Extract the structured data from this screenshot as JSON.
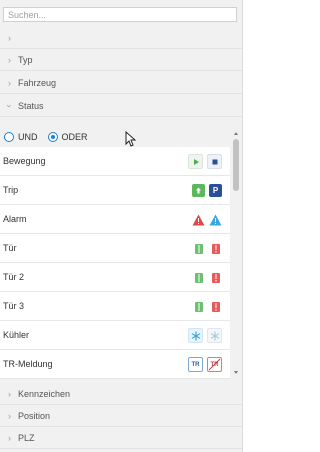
{
  "search": {
    "placeholder": "Suchen..."
  },
  "groups": {
    "unnamed": {
      "label": ""
    },
    "typ": {
      "label": "Typ"
    },
    "fahrzeug": {
      "label": "Fahrzeug"
    },
    "status": {
      "label": "Status",
      "expanded": true
    },
    "kennzeichen": {
      "label": "Kennzeichen"
    },
    "position": {
      "label": "Position"
    },
    "plz": {
      "label": "PLZ"
    }
  },
  "logic": {
    "und_label": "UND",
    "oder_label": "ODER",
    "selected": "ODER"
  },
  "status_items": [
    {
      "label": "Bewegung",
      "icons": [
        "play-icon",
        "stop-icon"
      ]
    },
    {
      "label": "Trip",
      "icons": [
        "trip-start-icon",
        "parking-icon"
      ]
    },
    {
      "label": "Alarm",
      "icons": [
        "alarm-red-icon",
        "alarm-blue-icon"
      ]
    },
    {
      "label": "Tür",
      "icons": [
        "door-closed-icon",
        "door-open-icon"
      ]
    },
    {
      "label": "Tür 2",
      "icons": [
        "door-closed-icon",
        "door-open-icon"
      ]
    },
    {
      "label": "Tür 3",
      "icons": [
        "door-closed-icon",
        "door-open-icon"
      ]
    },
    {
      "label": "Kühler",
      "icons": [
        "snowflake-on-icon",
        "snowflake-off-icon"
      ]
    },
    {
      "label": "TR-Meldung",
      "icons": [
        "tr-icon",
        "tr-off-icon"
      ]
    }
  ],
  "icon_glyphs": {
    "tr": "TR",
    "trip_p": "P"
  },
  "colors": {
    "green": "#5cb85c",
    "blue": "#1e7fd0",
    "red": "#e04848",
    "navy": "#2a4f9a",
    "door_red": "#e85b5b",
    "cyan": "#39a8e0"
  }
}
